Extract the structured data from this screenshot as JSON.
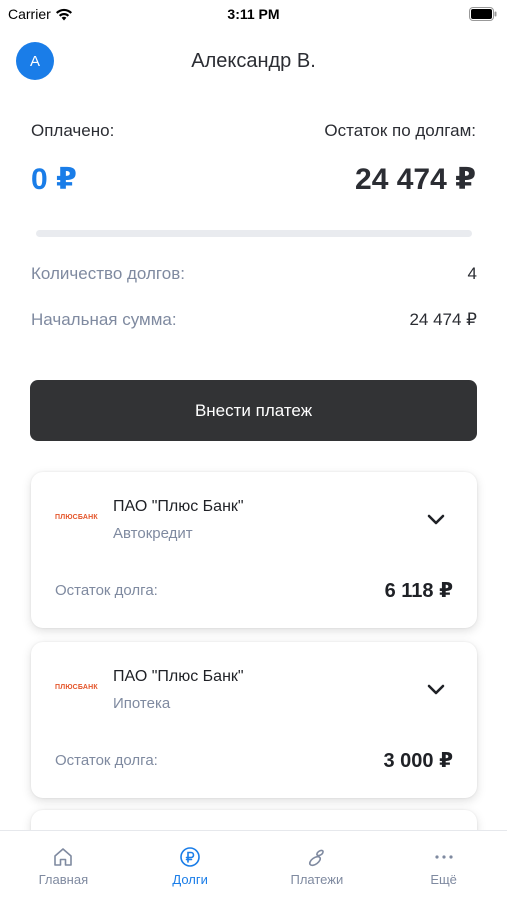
{
  "status_bar": {
    "carrier": "Carrier",
    "time": "3:11 PM"
  },
  "header": {
    "avatar_letter": "A",
    "user_name": "Александр В."
  },
  "summary": {
    "paid_label": "Оплачено:",
    "paid_value": "0 ₽",
    "remaining_label": "Остаток по долгам:",
    "remaining_value": "24 474 ₽",
    "progress_fraction": 0
  },
  "stats": [
    {
      "label": "Количество долгов:",
      "value": "4"
    },
    {
      "label": "Начальная сумма:",
      "value": "24 474 ₽"
    }
  ],
  "pay_button_label": "Внести платеж",
  "debts": [
    {
      "logo_text": "ПЛЮСБАНК",
      "bank": "ПАО \"Плюс Банк\"",
      "type": "Автокредит",
      "remain_label": "Остаток долга:",
      "remain_value": "6 118 ₽"
    },
    {
      "logo_text": "ПЛЮСБАНК",
      "bank": "ПАО \"Плюс Банк\"",
      "type": "Ипотека",
      "remain_label": "Остаток долга:",
      "remain_value": "3 000 ₽"
    }
  ],
  "tabs": [
    {
      "label": "Главная",
      "icon": "home-icon",
      "active": false
    },
    {
      "label": "Долги",
      "icon": "ruble-icon",
      "active": true
    },
    {
      "label": "Платежи",
      "icon": "payments-icon",
      "active": false
    },
    {
      "label": "Ещё",
      "icon": "more-icon",
      "active": false
    }
  ],
  "colors": {
    "accent": "#1a7de8",
    "button": "#323335",
    "muted": "#7f8aa0",
    "text": "#2b2d33"
  }
}
